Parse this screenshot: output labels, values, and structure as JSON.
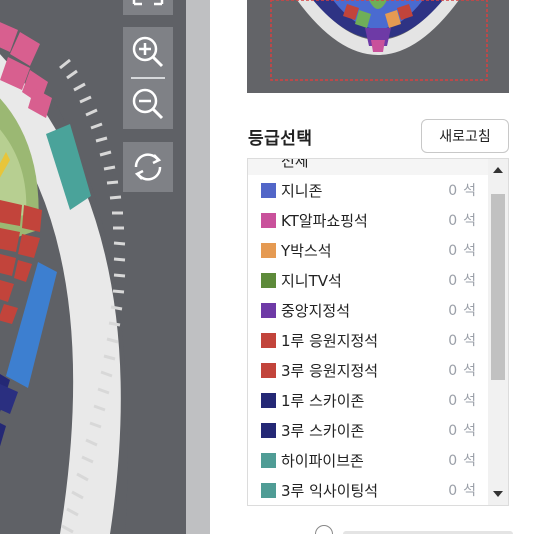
{
  "grade_panel": {
    "title": "등급선택",
    "refresh_label": "새로고침"
  },
  "grades": [
    {
      "label": "전체",
      "count": "",
      "unit": "",
      "color": ""
    },
    {
      "label": "지니존",
      "count": "0",
      "unit": "석",
      "color": "#5266c8"
    },
    {
      "label": "KT알파쇼핑석",
      "count": "0",
      "unit": "석",
      "color": "#c9519b"
    },
    {
      "label": "Y박스석",
      "count": "0",
      "unit": "석",
      "color": "#e59a52"
    },
    {
      "label": "지니TV석",
      "count": "0",
      "unit": "석",
      "color": "#5d8a3a"
    },
    {
      "label": "중앙지정석",
      "count": "0",
      "unit": "석",
      "color": "#6e3aa6"
    },
    {
      "label": "1루 응원지정석",
      "count": "0",
      "unit": "석",
      "color": "#c2443b"
    },
    {
      "label": "3루 응원지정석",
      "count": "0",
      "unit": "석",
      "color": "#c2443b"
    },
    {
      "label": "1루 스카이존",
      "count": "0",
      "unit": "석",
      "color": "#242875"
    },
    {
      "label": "3루 스카이존",
      "count": "0",
      "unit": "석",
      "color": "#242875"
    },
    {
      "label": "하이파이브존",
      "count": "0",
      "unit": "석",
      "color": "#4f9c95"
    },
    {
      "label": "3루 익사이팅석",
      "count": "0",
      "unit": "석",
      "color": "#4f9c95"
    }
  ],
  "icons": {
    "fullscreen": "fullscreen-icon",
    "zoom_in": "zoom-in-icon",
    "zoom_out": "zoom-out-icon",
    "reset": "refresh-icon",
    "scroll_up": "arrow-up-icon",
    "scroll_down": "arrow-down-icon"
  },
  "colors": {
    "panel_bg": "#ffffff",
    "map_bg": "#5f6166",
    "tool_bg": "#7f8186",
    "count_text": "#9a9fa8"
  }
}
